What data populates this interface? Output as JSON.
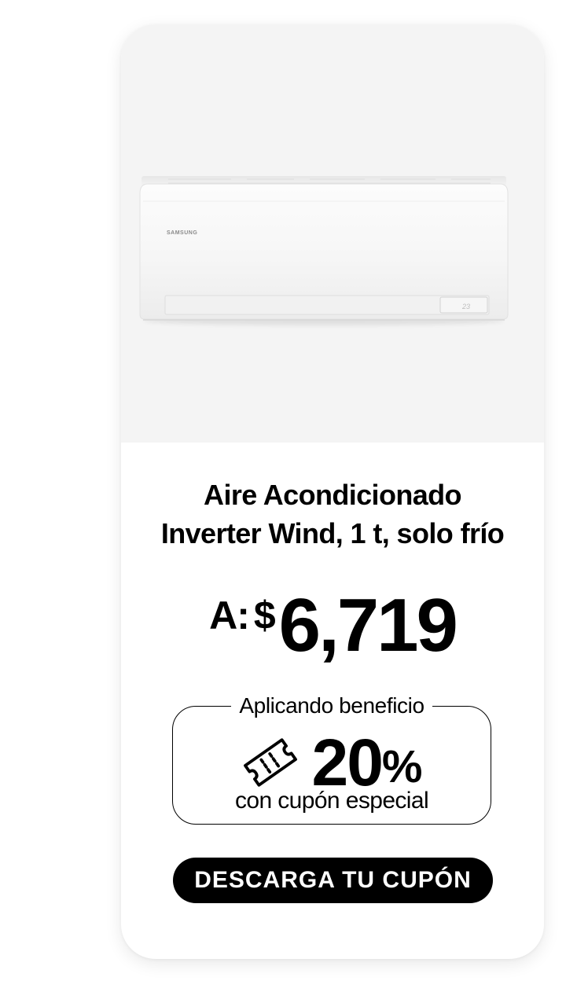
{
  "product": {
    "image_alt": "Samsung wall-mounted air conditioner unit",
    "brand_mark": "SAMSUNG",
    "display_readout": "23",
    "title_line1": "Aire Acondicionado",
    "title_line2": "Inverter Wind, 1 t, solo frío"
  },
  "price": {
    "prefix": "A:",
    "currency": "$",
    "value": "6,719"
  },
  "benefit": {
    "label": "Aplicando beneficio",
    "percent": "20",
    "percent_sign": "%",
    "subtitle": "con cupón especial",
    "icon": "ticket-icon"
  },
  "cta": {
    "label": "DESCARGA TU CUPÓN"
  },
  "colors": {
    "image_bg": "#f4f4f4",
    "card_bg": "#ffffff",
    "text": "#000000",
    "button_bg": "#000000",
    "button_text": "#ffffff"
  }
}
